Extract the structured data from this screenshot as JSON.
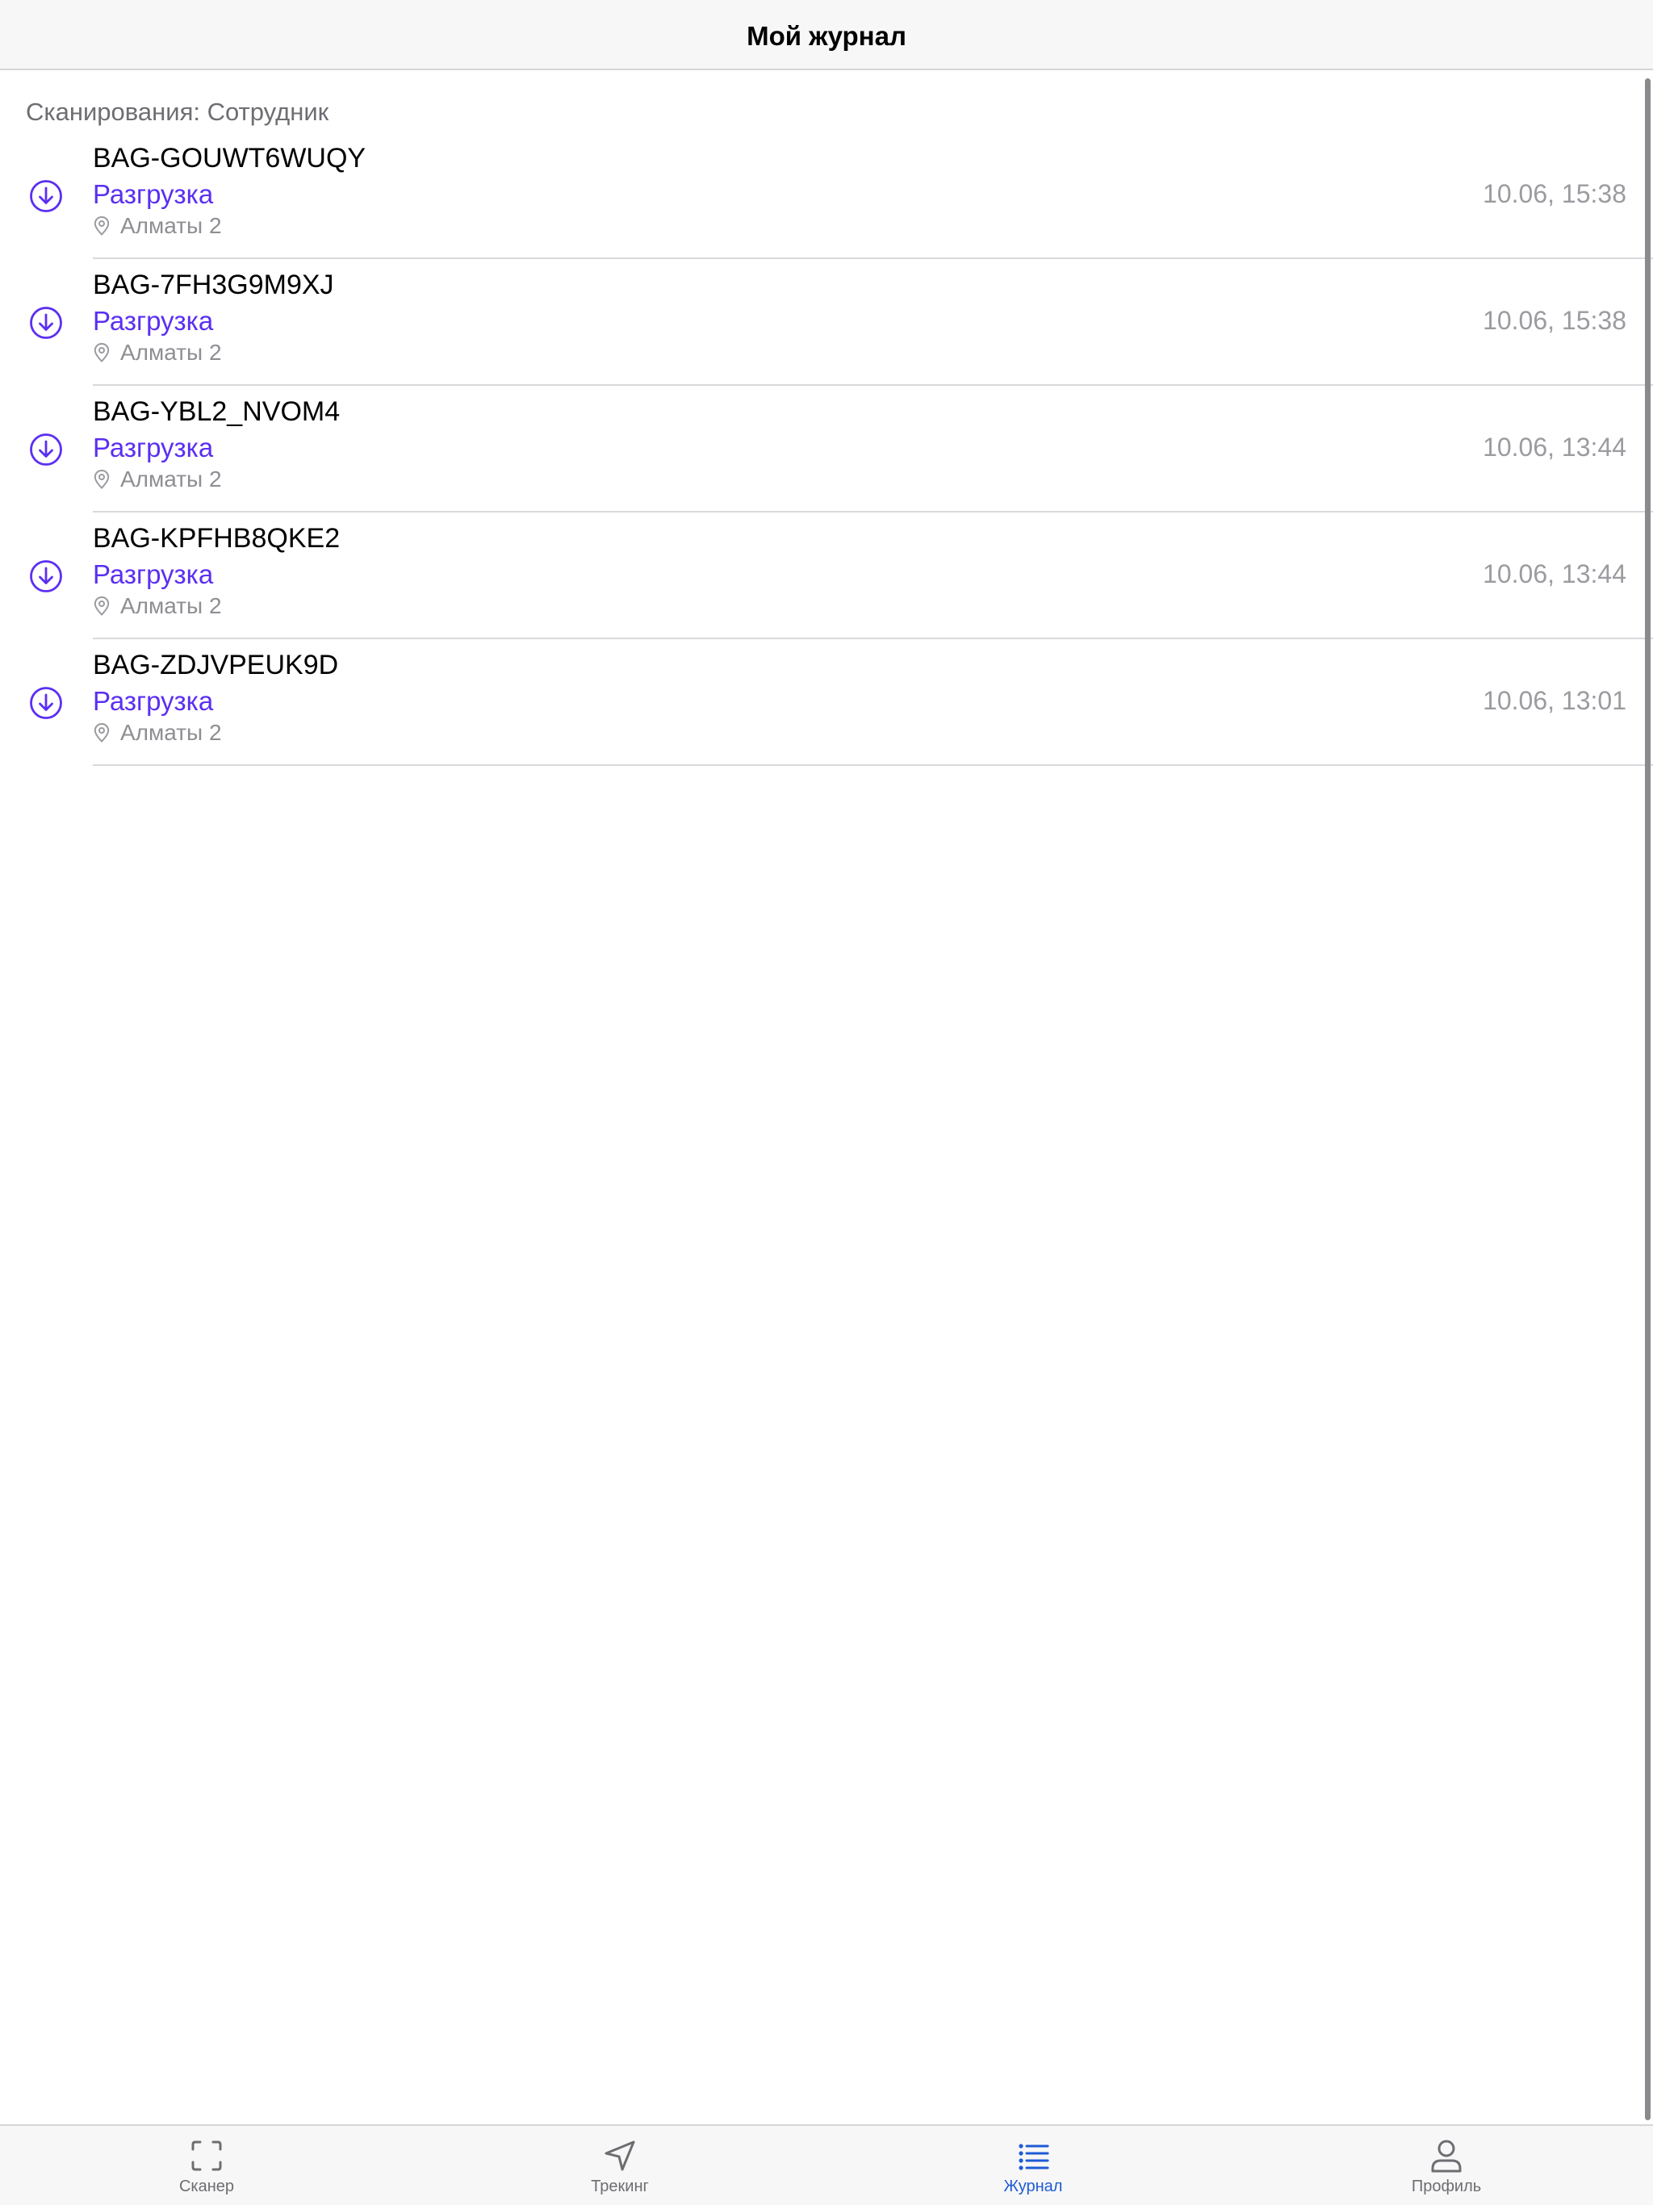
{
  "nav": {
    "title": "Мой журнал"
  },
  "section": {
    "header": "Сканирования: Сотрудник"
  },
  "rows": [
    {
      "code": "BAG-GOUWT6WUQY",
      "type": "Разгрузка",
      "location": "Алматы 2",
      "time": "10.06, 15:38"
    },
    {
      "code": "BAG-7FH3G9M9XJ",
      "type": "Разгрузка",
      "location": "Алматы 2",
      "time": "10.06, 15:38"
    },
    {
      "code": "BAG-YBL2_NVOM4",
      "type": "Разгрузка",
      "location": "Алматы 2",
      "time": "10.06, 13:44"
    },
    {
      "code": "BAG-KPFHB8QKE2",
      "type": "Разгрузка",
      "location": "Алматы 2",
      "time": "10.06, 13:44"
    },
    {
      "code": "BAG-ZDJVPEUK9D",
      "type": "Разгрузка",
      "location": "Алматы 2",
      "time": "10.06, 13:01"
    }
  ],
  "tabs": [
    {
      "label": "Сканер",
      "icon": "scanner-icon",
      "active": false
    },
    {
      "label": "Трекинг",
      "icon": "navigation-arrow-icon",
      "active": false
    },
    {
      "label": "Журнал",
      "icon": "list-icon",
      "active": true
    },
    {
      "label": "Профиль",
      "icon": "person-icon",
      "active": false
    }
  ],
  "colors": {
    "accent_purple": "#5b2ff2",
    "tab_active_blue": "#1f5bd6",
    "secondary_gray": "#8e8e93"
  }
}
